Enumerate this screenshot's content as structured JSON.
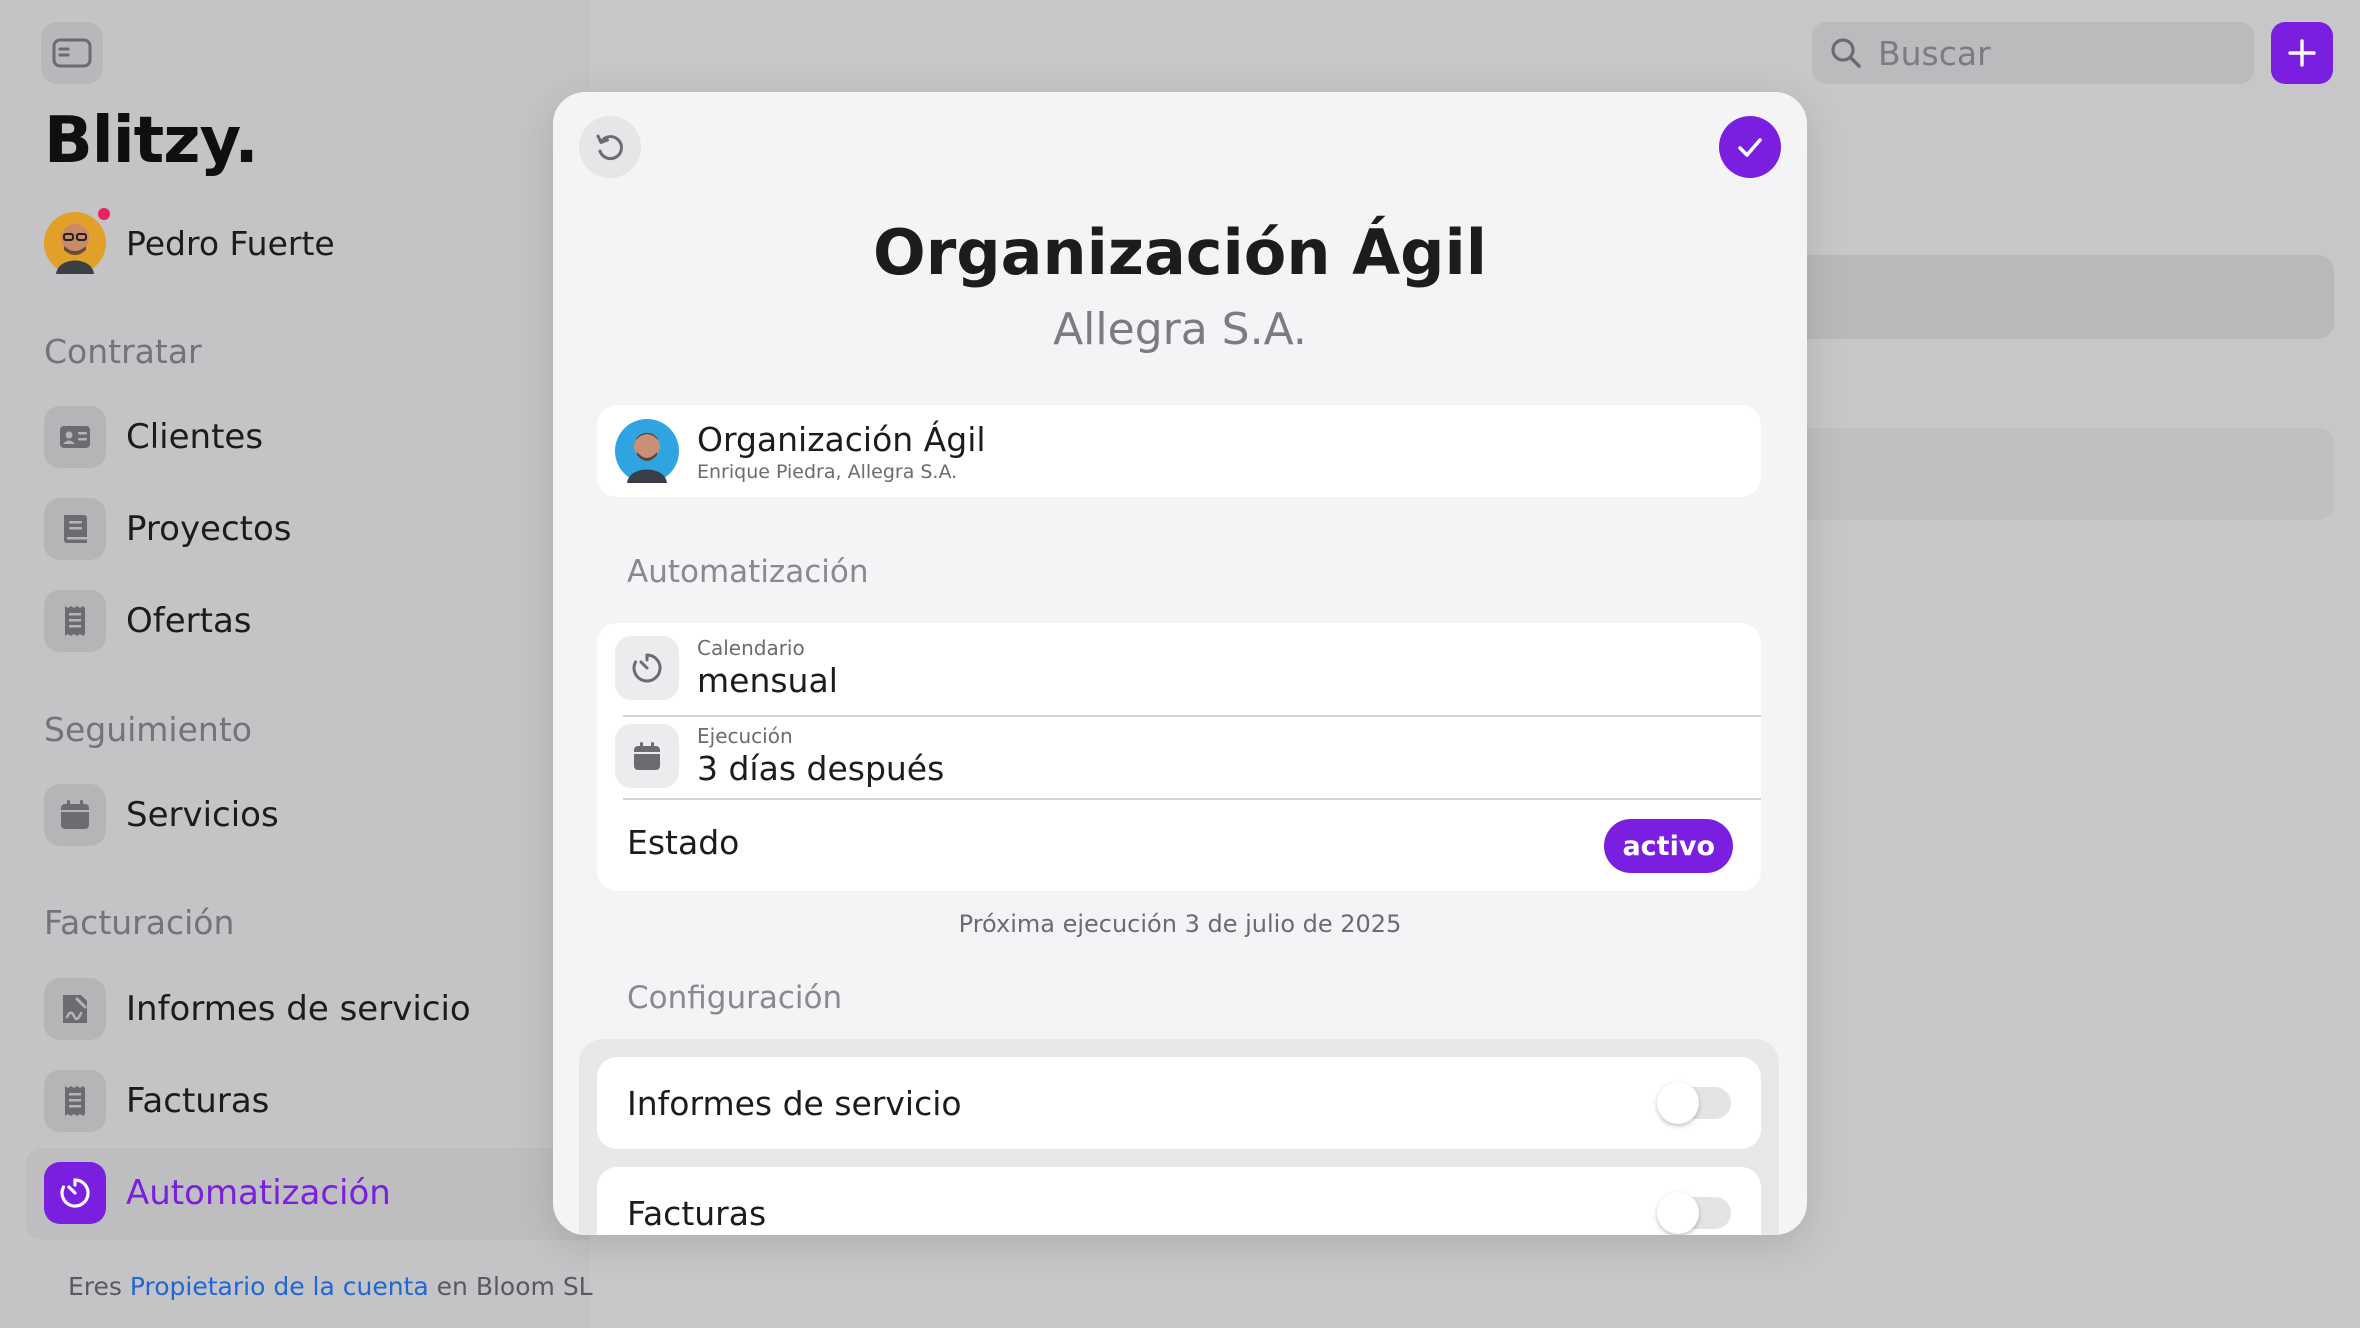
{
  "app": {
    "brand": "Blitzy.",
    "user_name": "Pedro Fuerte"
  },
  "sidebar": {
    "sections": [
      {
        "title": "Contratar",
        "items": [
          {
            "label": "Clientes",
            "icon": "contact-card-icon"
          },
          {
            "label": "Proyectos",
            "icon": "book-icon"
          },
          {
            "label": "Ofertas",
            "icon": "receipt-icon"
          }
        ]
      },
      {
        "title": "Seguimiento",
        "items": [
          {
            "label": "Servicios",
            "icon": "calendar-icon"
          }
        ]
      },
      {
        "title": "Facturación",
        "items": [
          {
            "label": "Informes de servicio",
            "icon": "report-signature-icon"
          },
          {
            "label": "Facturas",
            "icon": "invoice-icon"
          },
          {
            "label": "Automatización",
            "icon": "timer-icon",
            "active": true
          }
        ]
      }
    ],
    "footer": {
      "prefix": "Eres",
      "role_link": "Propietario de la cuenta",
      "middle": "en",
      "company": "Bloom SL"
    }
  },
  "header": {
    "search_placeholder": "Buscar",
    "add_icon": "plus-icon"
  },
  "modal": {
    "title": "Organización Ágil",
    "subtitle": "Allegra S.A.",
    "project": {
      "name": "Organización Ágil",
      "meta": "Enrique Piedra, Allegra S.A."
    },
    "automation": {
      "section_label": "Automatización",
      "schedule": {
        "caption": "Calendario",
        "value": "mensual",
        "icon": "timer-icon"
      },
      "execution": {
        "caption": "Ejecución",
        "value": "3 días después",
        "icon": "calendar-icon"
      },
      "status_label": "Estado",
      "status_value": "activo",
      "next_run": "Próxima ejecución 3 de julio de 2025"
    },
    "configuration": {
      "section_label": "Configuración",
      "toggles": [
        {
          "label": "Informes de servicio",
          "on": false
        },
        {
          "label": "Facturas",
          "on": false
        }
      ]
    }
  },
  "colors": {
    "accent": "#7a1fe0",
    "link": "#1f66d6",
    "notification_dot": "#e8245f"
  }
}
